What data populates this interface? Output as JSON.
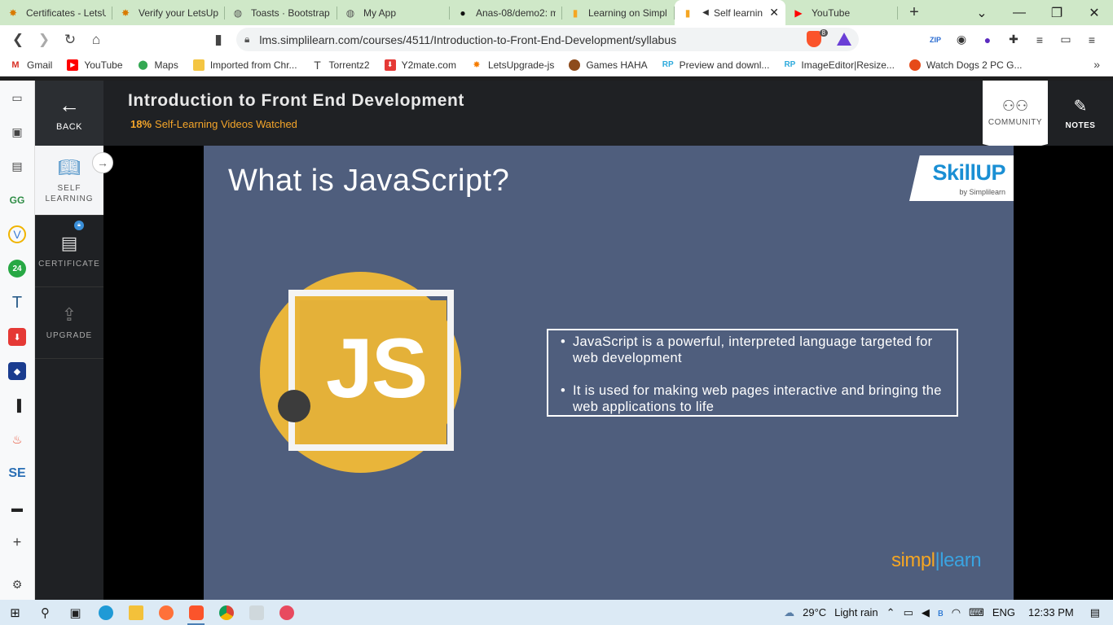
{
  "browser": {
    "tabs": [
      {
        "title": "Certificates - LetsU",
        "icon": "letsupgrade-icon",
        "active": false
      },
      {
        "title": "Verify your LetsUp",
        "icon": "letsupgrade-icon",
        "active": false
      },
      {
        "title": "Toasts · Bootstrap",
        "icon": "globe-icon",
        "active": false
      },
      {
        "title": "My App",
        "icon": "globe-icon",
        "active": false
      },
      {
        "title": "Anas-08/demo2: m",
        "icon": "github-icon",
        "active": false
      },
      {
        "title": "Learning on Simpl",
        "icon": "simplilearn-icon",
        "active": false
      },
      {
        "title": "Self learnin",
        "icon": "simplilearn-icon",
        "active": true
      },
      {
        "title": "YouTube",
        "icon": "youtube-icon",
        "active": false
      }
    ],
    "url": "lms.simplilearn.com/courses/4511/Introduction-to-Front-End-Development/syllabus",
    "brave_badge": "8",
    "bookmarks": [
      {
        "label": "Gmail",
        "icon": "gmail-icon",
        "color": "#d93025"
      },
      {
        "label": "YouTube",
        "icon": "youtube-icon",
        "color": "#ff0000"
      },
      {
        "label": "Maps",
        "icon": "maps-icon",
        "color": "#34a853"
      },
      {
        "label": "Imported from Chr...",
        "icon": "folder-icon",
        "color": "#f4c542"
      },
      {
        "label": "Torrentz2",
        "icon": "torrentz-icon",
        "color": "#444444"
      },
      {
        "label": "Y2mate.com",
        "icon": "y2mate-icon",
        "color": "#e53935"
      },
      {
        "label": "LetsUpgrade-js",
        "icon": "letsupgrade-icon",
        "color": "#f57c00"
      },
      {
        "label": "Games HAHA",
        "icon": "games-icon",
        "color": "#8d4b1b"
      },
      {
        "label": "Preview and downl...",
        "icon": "rp-icon",
        "color": "#2eaadc"
      },
      {
        "label": "ImageEditor|Resize...",
        "icon": "rp-icon",
        "color": "#2eaadc"
      },
      {
        "label": "Watch Dogs 2 PC G...",
        "icon": "watchdogs-icon",
        "color": "#e64a19"
      }
    ]
  },
  "header": {
    "back_label": "BACK",
    "course_title": "Introduction to Front End Development",
    "progress_percent": "18%",
    "progress_text": "Self-Learning Videos Watched",
    "community_label": "COMMUNITY",
    "notes_label": "NOTES"
  },
  "left_nav": {
    "self_learning": "SELF\nLEARNING",
    "certificate": "CERTIFICATE",
    "upgrade": "UPGRADE"
  },
  "slide": {
    "title": "What is JavaScript?",
    "logo_text": "JS",
    "skillup_title": "SkillUP",
    "skillup_sub": "by Simplilearn",
    "bullets": [
      "JavaScript is a powerful, interpreted language targeted for web development",
      "It is used for making web pages interactive and bringing the web applications to life"
    ],
    "brand_left": "simpl",
    "brand_right": "learn"
  },
  "taskbar": {
    "temperature": "29°C",
    "weather": "Light rain",
    "language": "ENG",
    "time": "12:33 PM"
  },
  "colors": {
    "accent_orange": "#f4a52a",
    "slide_bg": "#4f5e7d",
    "js_yellow": "#e9b53a",
    "skillup_blue": "#1a8fd4"
  }
}
